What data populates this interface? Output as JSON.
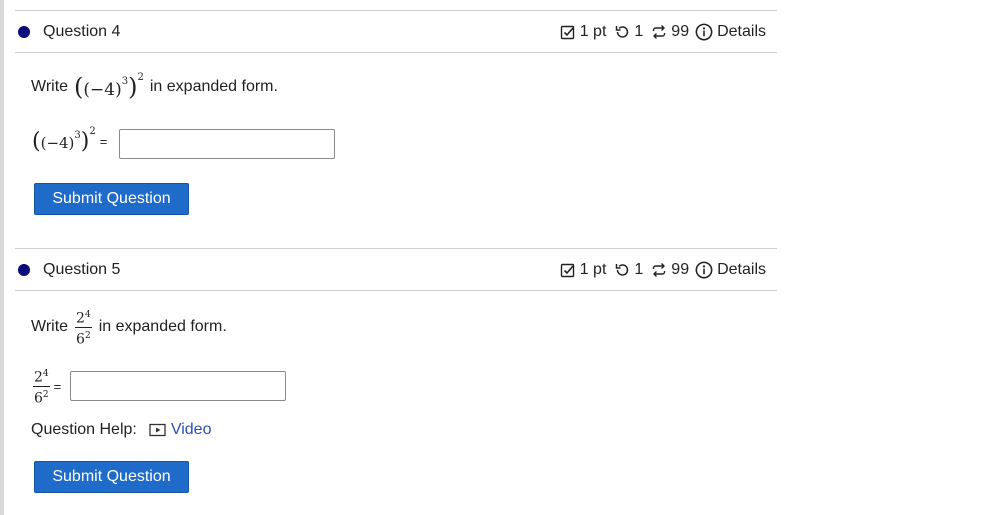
{
  "questions": [
    {
      "title": "Question 4",
      "points": "1 pt",
      "attempts": "1",
      "tries": "99",
      "details_label": "Details",
      "prompt_before": "Write",
      "prompt_after": "in expanded form.",
      "expression": {
        "base": "(−4)",
        "inner_exp": "3",
        "outer_exp": "2"
      },
      "equals": "=",
      "answer_value": "",
      "submit_label": "Submit Question"
    },
    {
      "title": "Question 5",
      "points": "1 pt",
      "attempts": "1",
      "tries": "99",
      "details_label": "Details",
      "prompt_before": "Write",
      "prompt_after": "in expanded form.",
      "expression": {
        "num_base": "2",
        "num_exp": "4",
        "den_base": "6",
        "den_exp": "2"
      },
      "equals": "=",
      "answer_value": "",
      "help_label": "Question Help:",
      "help_link": "Video",
      "submit_label": "Submit Question"
    }
  ],
  "colors": {
    "accent": "#1f6bc9",
    "dot": "#0a0a7a",
    "link": "#2b4fb8"
  },
  "icons": [
    "checkbox-icon",
    "retry-icon",
    "repeat-icon",
    "info-icon",
    "video-icon"
  ]
}
